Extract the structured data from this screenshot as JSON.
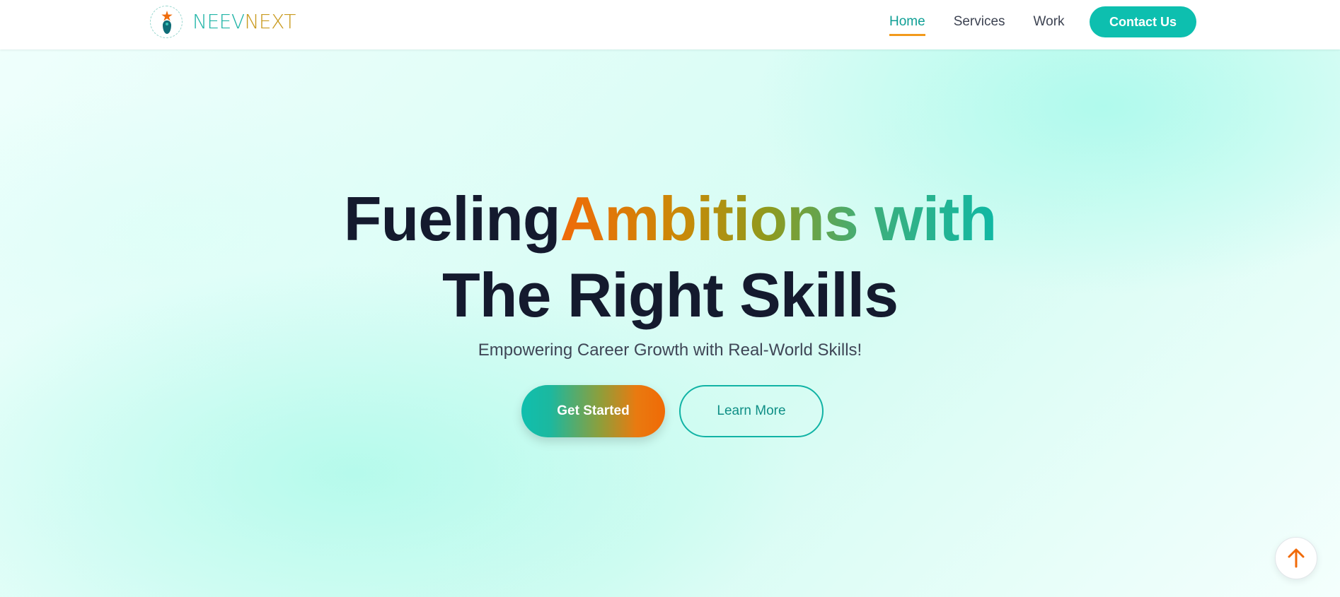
{
  "brand": {
    "name_part1": "NEEV",
    "name_part2": "NEXT",
    "logo_icon": "rocket-star-logo-icon"
  },
  "nav": {
    "items": [
      {
        "label": "Home",
        "active": true
      },
      {
        "label": "Services",
        "active": false
      },
      {
        "label": "Work",
        "active": false
      }
    ],
    "contact_label": "Contact Us"
  },
  "hero": {
    "headline_part1": "Fueling",
    "headline_highlight": "Ambitions with",
    "headline_line2": "The Right Skills",
    "subtitle": "Empowering Career Growth with Real-World Skills!",
    "primary_cta": "Get Started",
    "secondary_cta": "Learn More"
  },
  "scroll_top": {
    "icon": "arrow-up-icon"
  },
  "colors": {
    "accent_teal": "#0dbfaf",
    "accent_orange": "#f06a08",
    "text_dark": "#141a2e",
    "nav_underline": "#f29a1c"
  }
}
